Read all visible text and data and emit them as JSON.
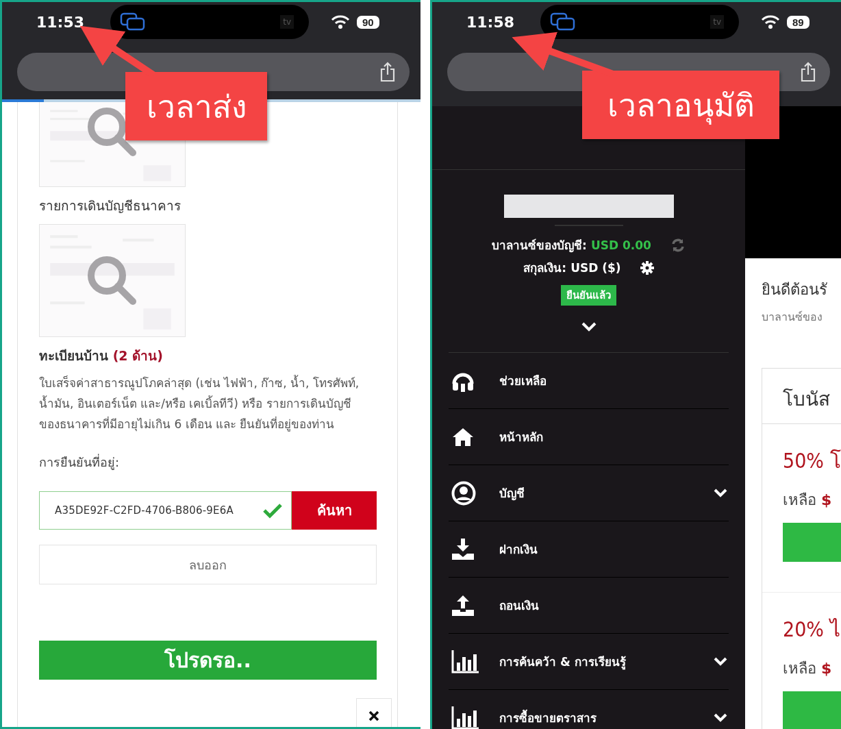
{
  "left_screen": {
    "status_bar": {
      "time": "11:53",
      "island_label": "tv",
      "battery": "90"
    },
    "page_load": {
      "level": 0.1
    },
    "documents": [
      {
        "caption": "รายการเดินบัญชีธนาคาร",
        "bold": false
      },
      {
        "caption": "ทะเบียนบ้าน",
        "caption_note": "(2 ด้าน)",
        "bold": true
      }
    ],
    "description": "ใบเสร็จค่าสาธารณูปโภคล่าสุด (เช่น ไฟฟ้า, ก๊าซ, น้ำ, โทรศัพท์, น้ำมัน, อินเตอร์เน็ต และ/หรือ เคเบิ้ลทีวี) หรือ รายการเดินบัญชีของธนาคารที่มีอายุไม่เกิน 6 เดือน และ ยืนยันที่อยู่ของท่าน",
    "address_proof": {
      "label": "การยืนยันที่อยู่:",
      "value": "A35DE92F-C2FD-4706-B806-9E6A",
      "valid": true,
      "search_button": "ค้นหา",
      "remove_button": "ลบออก"
    },
    "submit_button": "โปรดรอ.."
  },
  "right_screen": {
    "status_bar": {
      "time": "11:58",
      "island_label": "tv",
      "battery": "89"
    },
    "sidebar": {
      "balance_label": "บาลานซ์ของบัญชี:",
      "balance": "USD 0.00",
      "currency_label": "สกุลเงิน:",
      "currency": "USD ($)",
      "verified_badge": "ยืนยันแล้ว",
      "menu": [
        {
          "label": "ช่วยเหลือ",
          "kind": "headset",
          "expandable": false
        },
        {
          "label": "หน้าหลัก",
          "kind": "home",
          "expandable": false
        },
        {
          "label": "บัญชี",
          "kind": "user",
          "expandable": true
        },
        {
          "label": "ฝากเงิน",
          "kind": "download",
          "expandable": false
        },
        {
          "label": "ถอนเงิน",
          "kind": "upload",
          "expandable": false
        },
        {
          "label": "การค้นคว้า & การเรียนรู้",
          "kind": "chart",
          "expandable": true
        },
        {
          "label": "การซื้อขายตราสาร",
          "kind": "chart",
          "expandable": true
        }
      ]
    },
    "main": {
      "welcome": "ยินดีต้อนรั",
      "balance_caption": "บาลานซ์ของ",
      "bonus_title": "โบนัส",
      "bonuses": [
        {
          "title": "50% โ",
          "remaining_label": "เหลือ",
          "remaining_amount": "$"
        },
        {
          "title": "20% ไ",
          "remaining_label": "เหลือ",
          "remaining_amount": "$"
        }
      ]
    }
  },
  "callouts": [
    {
      "text": "เวลาส่ง"
    },
    {
      "text": "เวลาอนุมัติ"
    }
  ]
}
